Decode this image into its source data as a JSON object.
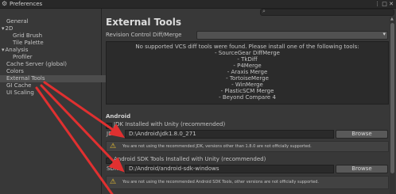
{
  "window": {
    "title": "Preferences"
  },
  "sidebar": {
    "items": [
      {
        "label": "General",
        "indent": 0
      },
      {
        "label": "2D",
        "indent": 0,
        "expander": "▾"
      },
      {
        "label": "Grid Brush",
        "indent": 1
      },
      {
        "label": "Tile Palette",
        "indent": 1
      },
      {
        "label": "Analysis",
        "indent": 0,
        "expander": "▾"
      },
      {
        "label": "Profiler",
        "indent": 1
      },
      {
        "label": "Cache Server (global)",
        "indent": 0
      },
      {
        "label": "Colors",
        "indent": 0
      },
      {
        "label": "External Tools",
        "indent": 0,
        "selected": true
      },
      {
        "label": "GI Cache",
        "indent": 0
      },
      {
        "label": "UI Scaling",
        "indent": 0
      }
    ]
  },
  "search": {
    "placeholder": "",
    "icon": "search-icon"
  },
  "main": {
    "title": "External Tools",
    "revision_control_label": "Revision Control Diff/Merge",
    "revision_control_value": "",
    "vcs_message": [
      "No supported VCS diff tools were found. Please install one of the following tools:",
      "- SourceGear DiffMerge",
      "- TkDiff",
      "- P4Merge",
      "- Araxis Merge",
      "- TortoiseMerge",
      "- WinMerge",
      "- PlasticSCM Merge",
      "- Beyond Compare 4"
    ],
    "android": {
      "section_title": "Android",
      "jdk_checkbox_label": "JDK Installed with Unity (recommended)",
      "jdk_label": "JDK",
      "jdk_path": "D:\\Android\\jdk1.8.0_271",
      "jdk_browse": "Browse",
      "jdk_warning": "You are not using the recommended JDK, versions other than 1.8.0 are not officially supported.",
      "sdk_checkbox_label": "Android SDK Tools Installed with Unity (recommended)",
      "sdk_label": "SDK",
      "sdk_path": "D:/Android/android-sdk-windows",
      "sdk_browse": "Browse",
      "sdk_warning": "You are not using the recommended Android SDK Tools, other versions are not officially supported."
    }
  },
  "colors": {
    "annotation_arrow": "#e03030",
    "warning": "#f0c530",
    "selection": "#4d4d4d"
  }
}
